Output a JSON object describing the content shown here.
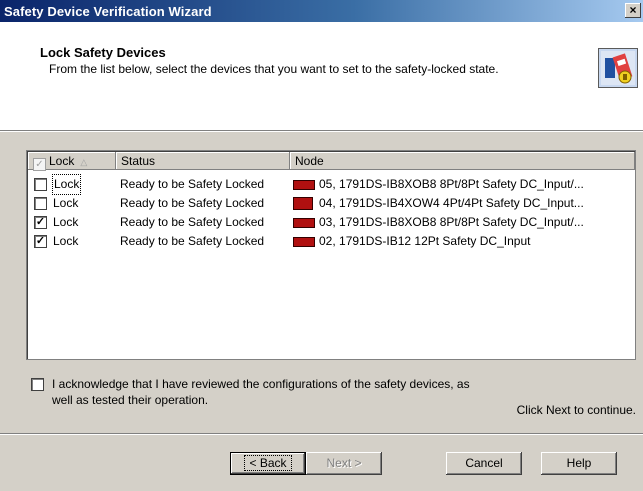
{
  "window": {
    "title": "Safety Device Verification Wizard",
    "close_glyph": "×"
  },
  "header": {
    "title": "Lock Safety Devices",
    "description": "From the list below, select the devices that you want to set to the safety-locked state.",
    "icon": "wizard-lock-icon"
  },
  "list": {
    "columns": {
      "lock": "Lock",
      "status": "Status",
      "node": "Node"
    },
    "rows": [
      {
        "checked": false,
        "lock": "Lock",
        "status": "Ready to be Safety Locked",
        "node": "05, 1791DS-IB8XOB8 8Pt/8Pt Safety DC_Input/...",
        "icon": "device-module-icon"
      },
      {
        "checked": false,
        "lock": "Lock",
        "status": "Ready to be Safety Locked",
        "node": "04, 1791DS-IB4XOW4 4Pt/4Pt Safety DC_Input...",
        "icon": "device-module-icon"
      },
      {
        "checked": true,
        "lock": "Lock",
        "status": "Ready to be Safety Locked",
        "node": "03, 1791DS-IB8XOB8 8Pt/8Pt Safety DC_Input/...",
        "icon": "device-module-icon"
      },
      {
        "checked": true,
        "lock": "Lock",
        "status": "Ready to be Safety Locked",
        "node": "02, 1791DS-IB12 12Pt Safety DC_Input",
        "icon": "device-module-icon"
      }
    ]
  },
  "acknowledge": {
    "checked": false,
    "text": "I acknowledge that I have reviewed the configurations of the safety devices, as well as tested their operation."
  },
  "hint": "Click Next to continue.",
  "buttons": {
    "back": "< Back",
    "next": "Next >",
    "cancel": "Cancel",
    "help": "Help"
  }
}
